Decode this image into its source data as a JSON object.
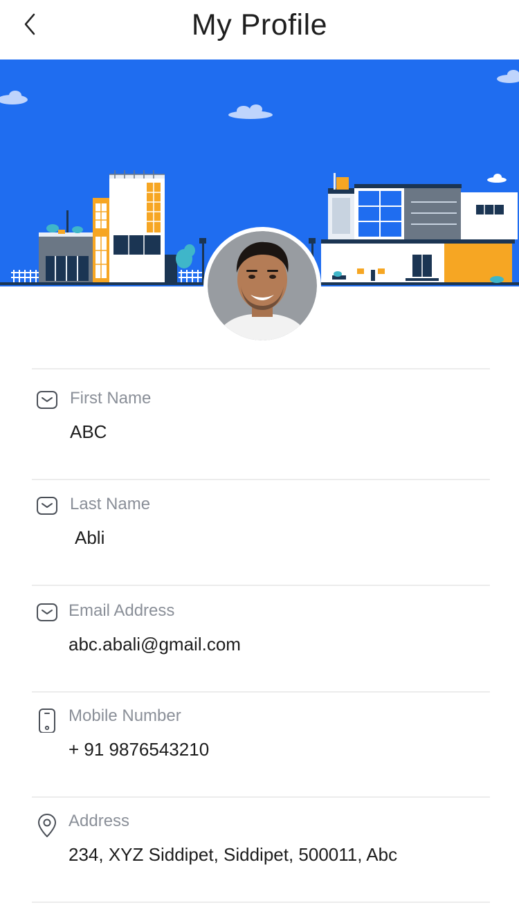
{
  "header": {
    "title": "My Profile",
    "back_icon": "chevron-left-icon"
  },
  "banner": {
    "sky_color": "#1f6df0",
    "accent_orange": "#f6a623",
    "dark_navy": "#1b3553"
  },
  "profile": {
    "avatar_icon": "user-avatar",
    "fields": [
      {
        "icon": "envelope-icon",
        "label": "First Name",
        "value": "ABC"
      },
      {
        "icon": "envelope-icon",
        "label": "Last Name",
        "value": "Abli"
      },
      {
        "icon": "envelope-icon",
        "label": "Email Address",
        "value": "abc.abali@gmail.com"
      },
      {
        "icon": "mobile-phone-icon",
        "label": "Mobile Number",
        "value": "+ 91 9876543210"
      },
      {
        "icon": "location-pin-icon",
        "label": "Address",
        "value": "234, XYZ Siddipet, Siddipet, 500011, Abc"
      }
    ]
  }
}
